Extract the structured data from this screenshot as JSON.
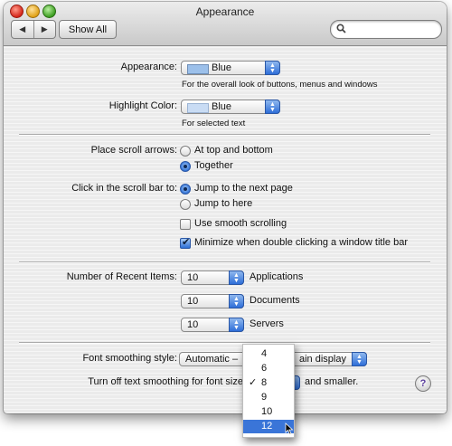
{
  "window": {
    "title": "Appearance"
  },
  "toolbar": {
    "back_glyph": "◀",
    "forward_glyph": "▶",
    "show_all_label": "Show All",
    "search_placeholder": ""
  },
  "appearance": {
    "label": "Appearance:",
    "value": "Blue",
    "description": "For the overall look of buttons, menus and windows"
  },
  "highlight": {
    "label": "Highlight Color:",
    "value": "Blue",
    "description": "For selected text"
  },
  "scroll_arrows": {
    "label": "Place scroll arrows:",
    "options": [
      "At top and bottom",
      "Together"
    ],
    "selected": "Together"
  },
  "scroll_bar_click": {
    "label": "Click in the scroll bar to:",
    "options": [
      "Jump to the next page",
      "Jump to here"
    ],
    "selected": "Jump to the next page"
  },
  "checkboxes": {
    "smooth_scrolling": {
      "label": "Use smooth scrolling",
      "checked": false
    },
    "minimize_double_click": {
      "label": "Minimize when double clicking a window title bar",
      "checked": true
    }
  },
  "recent_items": {
    "label": "Number of Recent Items:",
    "rows": [
      {
        "value": "10",
        "label": "Applications"
      },
      {
        "value": "10",
        "label": "Documents"
      },
      {
        "value": "10",
        "label": "Servers"
      }
    ]
  },
  "font_smoothing": {
    "label": "Font smoothing style:",
    "value_visible_left": "Automatic –",
    "value_visible_right": "ain display"
  },
  "text_smoothing": {
    "label": "Turn off text smoothing for font size",
    "suffix": "and smaller.",
    "menu_options": [
      "4",
      "6",
      "8",
      "9",
      "10",
      "12"
    ],
    "checked_option": "8",
    "highlighted_option": "12"
  },
  "colors": {
    "accent": "#3a75d8",
    "swatch_blue": "#9cc0ea"
  }
}
